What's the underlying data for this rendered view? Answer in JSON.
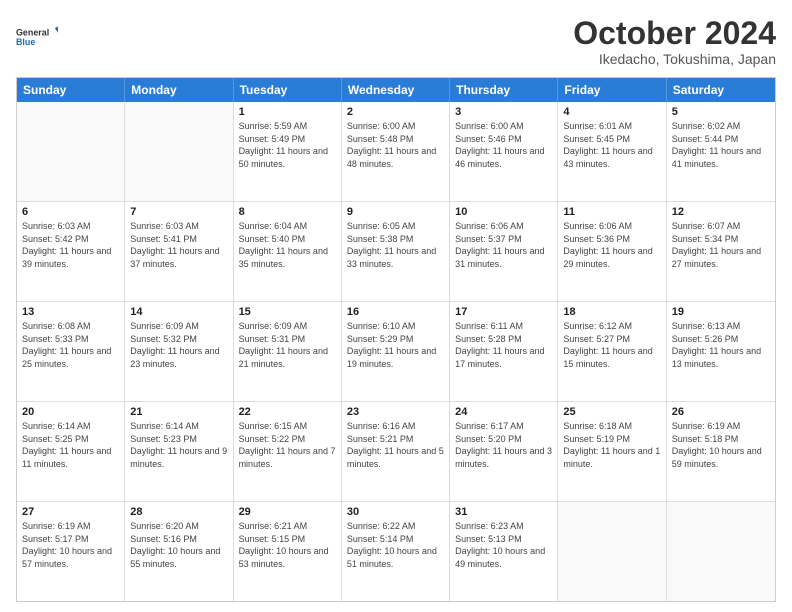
{
  "logo": {
    "line1": "General",
    "line2": "Blue"
  },
  "title": "October 2024",
  "location": "Ikedacho, Tokushima, Japan",
  "weekdays": [
    "Sunday",
    "Monday",
    "Tuesday",
    "Wednesday",
    "Thursday",
    "Friday",
    "Saturday"
  ],
  "weeks": [
    [
      {
        "day": "",
        "sunrise": "",
        "sunset": "",
        "daylight": ""
      },
      {
        "day": "",
        "sunrise": "",
        "sunset": "",
        "daylight": ""
      },
      {
        "day": "1",
        "sunrise": "Sunrise: 5:59 AM",
        "sunset": "Sunset: 5:49 PM",
        "daylight": "Daylight: 11 hours and 50 minutes."
      },
      {
        "day": "2",
        "sunrise": "Sunrise: 6:00 AM",
        "sunset": "Sunset: 5:48 PM",
        "daylight": "Daylight: 11 hours and 48 minutes."
      },
      {
        "day": "3",
        "sunrise": "Sunrise: 6:00 AM",
        "sunset": "Sunset: 5:46 PM",
        "daylight": "Daylight: 11 hours and 46 minutes."
      },
      {
        "day": "4",
        "sunrise": "Sunrise: 6:01 AM",
        "sunset": "Sunset: 5:45 PM",
        "daylight": "Daylight: 11 hours and 43 minutes."
      },
      {
        "day": "5",
        "sunrise": "Sunrise: 6:02 AM",
        "sunset": "Sunset: 5:44 PM",
        "daylight": "Daylight: 11 hours and 41 minutes."
      }
    ],
    [
      {
        "day": "6",
        "sunrise": "Sunrise: 6:03 AM",
        "sunset": "Sunset: 5:42 PM",
        "daylight": "Daylight: 11 hours and 39 minutes."
      },
      {
        "day": "7",
        "sunrise": "Sunrise: 6:03 AM",
        "sunset": "Sunset: 5:41 PM",
        "daylight": "Daylight: 11 hours and 37 minutes."
      },
      {
        "day": "8",
        "sunrise": "Sunrise: 6:04 AM",
        "sunset": "Sunset: 5:40 PM",
        "daylight": "Daylight: 11 hours and 35 minutes."
      },
      {
        "day": "9",
        "sunrise": "Sunrise: 6:05 AM",
        "sunset": "Sunset: 5:38 PM",
        "daylight": "Daylight: 11 hours and 33 minutes."
      },
      {
        "day": "10",
        "sunrise": "Sunrise: 6:06 AM",
        "sunset": "Sunset: 5:37 PM",
        "daylight": "Daylight: 11 hours and 31 minutes."
      },
      {
        "day": "11",
        "sunrise": "Sunrise: 6:06 AM",
        "sunset": "Sunset: 5:36 PM",
        "daylight": "Daylight: 11 hours and 29 minutes."
      },
      {
        "day": "12",
        "sunrise": "Sunrise: 6:07 AM",
        "sunset": "Sunset: 5:34 PM",
        "daylight": "Daylight: 11 hours and 27 minutes."
      }
    ],
    [
      {
        "day": "13",
        "sunrise": "Sunrise: 6:08 AM",
        "sunset": "Sunset: 5:33 PM",
        "daylight": "Daylight: 11 hours and 25 minutes."
      },
      {
        "day": "14",
        "sunrise": "Sunrise: 6:09 AM",
        "sunset": "Sunset: 5:32 PM",
        "daylight": "Daylight: 11 hours and 23 minutes."
      },
      {
        "day": "15",
        "sunrise": "Sunrise: 6:09 AM",
        "sunset": "Sunset: 5:31 PM",
        "daylight": "Daylight: 11 hours and 21 minutes."
      },
      {
        "day": "16",
        "sunrise": "Sunrise: 6:10 AM",
        "sunset": "Sunset: 5:29 PM",
        "daylight": "Daylight: 11 hours and 19 minutes."
      },
      {
        "day": "17",
        "sunrise": "Sunrise: 6:11 AM",
        "sunset": "Sunset: 5:28 PM",
        "daylight": "Daylight: 11 hours and 17 minutes."
      },
      {
        "day": "18",
        "sunrise": "Sunrise: 6:12 AM",
        "sunset": "Sunset: 5:27 PM",
        "daylight": "Daylight: 11 hours and 15 minutes."
      },
      {
        "day": "19",
        "sunrise": "Sunrise: 6:13 AM",
        "sunset": "Sunset: 5:26 PM",
        "daylight": "Daylight: 11 hours and 13 minutes."
      }
    ],
    [
      {
        "day": "20",
        "sunrise": "Sunrise: 6:14 AM",
        "sunset": "Sunset: 5:25 PM",
        "daylight": "Daylight: 11 hours and 11 minutes."
      },
      {
        "day": "21",
        "sunrise": "Sunrise: 6:14 AM",
        "sunset": "Sunset: 5:23 PM",
        "daylight": "Daylight: 11 hours and 9 minutes."
      },
      {
        "day": "22",
        "sunrise": "Sunrise: 6:15 AM",
        "sunset": "Sunset: 5:22 PM",
        "daylight": "Daylight: 11 hours and 7 minutes."
      },
      {
        "day": "23",
        "sunrise": "Sunrise: 6:16 AM",
        "sunset": "Sunset: 5:21 PM",
        "daylight": "Daylight: 11 hours and 5 minutes."
      },
      {
        "day": "24",
        "sunrise": "Sunrise: 6:17 AM",
        "sunset": "Sunset: 5:20 PM",
        "daylight": "Daylight: 11 hours and 3 minutes."
      },
      {
        "day": "25",
        "sunrise": "Sunrise: 6:18 AM",
        "sunset": "Sunset: 5:19 PM",
        "daylight": "Daylight: 11 hours and 1 minute."
      },
      {
        "day": "26",
        "sunrise": "Sunrise: 6:19 AM",
        "sunset": "Sunset: 5:18 PM",
        "daylight": "Daylight: 10 hours and 59 minutes."
      }
    ],
    [
      {
        "day": "27",
        "sunrise": "Sunrise: 6:19 AM",
        "sunset": "Sunset: 5:17 PM",
        "daylight": "Daylight: 10 hours and 57 minutes."
      },
      {
        "day": "28",
        "sunrise": "Sunrise: 6:20 AM",
        "sunset": "Sunset: 5:16 PM",
        "daylight": "Daylight: 10 hours and 55 minutes."
      },
      {
        "day": "29",
        "sunrise": "Sunrise: 6:21 AM",
        "sunset": "Sunset: 5:15 PM",
        "daylight": "Daylight: 10 hours and 53 minutes."
      },
      {
        "day": "30",
        "sunrise": "Sunrise: 6:22 AM",
        "sunset": "Sunset: 5:14 PM",
        "daylight": "Daylight: 10 hours and 51 minutes."
      },
      {
        "day": "31",
        "sunrise": "Sunrise: 6:23 AM",
        "sunset": "Sunset: 5:13 PM",
        "daylight": "Daylight: 10 hours and 49 minutes."
      },
      {
        "day": "",
        "sunrise": "",
        "sunset": "",
        "daylight": ""
      },
      {
        "day": "",
        "sunrise": "",
        "sunset": "",
        "daylight": ""
      }
    ]
  ]
}
